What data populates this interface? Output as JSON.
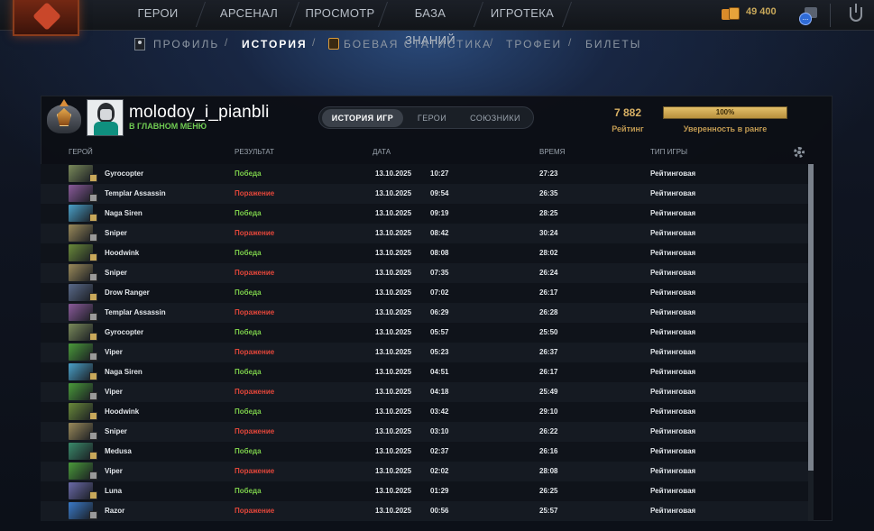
{
  "top_nav": {
    "items": [
      "ГЕРОИ",
      "АРСЕНАЛ",
      "ПРОСМОТР",
      "БАЗА ЗНАНИЙ",
      "ИГРОТЕКА"
    ],
    "shards": "49 400",
    "messages": "...",
    "logo_icon": "dota2-logo-icon",
    "coins_icon": "shards-coins-icon",
    "shield_icon": "shield-icon"
  },
  "sub_nav": {
    "items": [
      "ПРОФИЛЬ",
      "ИСТОРИЯ",
      "БОЕВАЯ СТАТИСТИКА",
      "ТРОФЕИ",
      "БИЛЕТЫ"
    ],
    "active": "ИСТОРИЯ",
    "separator": "/"
  },
  "profile": {
    "username": "molodoy_i_pianbli",
    "status": "В ГЛАВНОМ МЕНЮ",
    "rating_value": "7 882",
    "rating_label": "Рейтинг",
    "confidence_value": "100%",
    "confidence_fraction": 1.0,
    "confidence_label": "Уверенность в ранге"
  },
  "tabs": {
    "items": [
      "ИСТОРИЯ ИГР",
      "ГЕРОИ",
      "СОЮЗНИКИ"
    ],
    "active": "ИСТОРИЯ ИГР"
  },
  "table": {
    "headers": [
      "ГЕРОЙ",
      "РЕЗУЛЬТАТ",
      "ДАТА",
      "ВРЕМЯ",
      "ТИП ИГРЫ"
    ],
    "rows": [
      {
        "hero": "Gyrocopter",
        "result": "Победа",
        "win": true,
        "date": "13.10.2025",
        "time": "10:27",
        "duration": "27:23",
        "type": "Рейтинговая",
        "color": "#7a8a5a"
      },
      {
        "hero": "Templar Assassin",
        "result": "Поражение",
        "win": false,
        "date": "13.10.2025",
        "time": "09:54",
        "duration": "26:35",
        "type": "Рейтинговая",
        "color": "#8a5a9a"
      },
      {
        "hero": "Naga Siren",
        "result": "Победа",
        "win": true,
        "date": "13.10.2025",
        "time": "09:19",
        "duration": "28:25",
        "type": "Рейтинговая",
        "color": "#4aa0c8"
      },
      {
        "hero": "Sniper",
        "result": "Поражение",
        "win": false,
        "date": "13.10.2025",
        "time": "08:42",
        "duration": "30:24",
        "type": "Рейтинговая",
        "color": "#9a8a5a"
      },
      {
        "hero": "Hoodwink",
        "result": "Победа",
        "win": true,
        "date": "13.10.2025",
        "time": "08:08",
        "duration": "28:02",
        "type": "Рейтинговая",
        "color": "#6a8a3a"
      },
      {
        "hero": "Sniper",
        "result": "Поражение",
        "win": false,
        "date": "13.10.2025",
        "time": "07:35",
        "duration": "26:24",
        "type": "Рейтинговая",
        "color": "#9a8a5a"
      },
      {
        "hero": "Drow Ranger",
        "result": "Победа",
        "win": true,
        "date": "13.10.2025",
        "time": "07:02",
        "duration": "26:17",
        "type": "Рейтинговая",
        "color": "#5a6a8a"
      },
      {
        "hero": "Templar Assassin",
        "result": "Поражение",
        "win": false,
        "date": "13.10.2025",
        "time": "06:29",
        "duration": "26:28",
        "type": "Рейтинговая",
        "color": "#8a5a9a"
      },
      {
        "hero": "Gyrocopter",
        "result": "Победа",
        "win": true,
        "date": "13.10.2025",
        "time": "05:57",
        "duration": "25:50",
        "type": "Рейтинговая",
        "color": "#7a8a5a"
      },
      {
        "hero": "Viper",
        "result": "Поражение",
        "win": false,
        "date": "13.10.2025",
        "time": "05:23",
        "duration": "26:37",
        "type": "Рейтинговая",
        "color": "#4a9a3a"
      },
      {
        "hero": "Naga Siren",
        "result": "Победа",
        "win": true,
        "date": "13.10.2025",
        "time": "04:51",
        "duration": "26:17",
        "type": "Рейтинговая",
        "color": "#4aa0c8"
      },
      {
        "hero": "Viper",
        "result": "Поражение",
        "win": false,
        "date": "13.10.2025",
        "time": "04:18",
        "duration": "25:49",
        "type": "Рейтинговая",
        "color": "#4a9a3a"
      },
      {
        "hero": "Hoodwink",
        "result": "Победа",
        "win": true,
        "date": "13.10.2025",
        "time": "03:42",
        "duration": "29:10",
        "type": "Рейтинговая",
        "color": "#6a8a3a"
      },
      {
        "hero": "Sniper",
        "result": "Поражение",
        "win": false,
        "date": "13.10.2025",
        "time": "03:10",
        "duration": "26:22",
        "type": "Рейтинговая",
        "color": "#9a8a5a"
      },
      {
        "hero": "Medusa",
        "result": "Победа",
        "win": true,
        "date": "13.10.2025",
        "time": "02:37",
        "duration": "26:16",
        "type": "Рейтинговая",
        "color": "#3a8a6a"
      },
      {
        "hero": "Viper",
        "result": "Поражение",
        "win": false,
        "date": "13.10.2025",
        "time": "02:02",
        "duration": "28:08",
        "type": "Рейтинговая",
        "color": "#4a9a3a"
      },
      {
        "hero": "Luna",
        "result": "Победа",
        "win": true,
        "date": "13.10.2025",
        "time": "01:29",
        "duration": "26:25",
        "type": "Рейтинговая",
        "color": "#6a6aa8"
      },
      {
        "hero": "Razor",
        "result": "Поражение",
        "win": false,
        "date": "13.10.2025",
        "time": "00:56",
        "duration": "25:57",
        "type": "Рейтинговая",
        "color": "#3a7ac8"
      }
    ]
  }
}
